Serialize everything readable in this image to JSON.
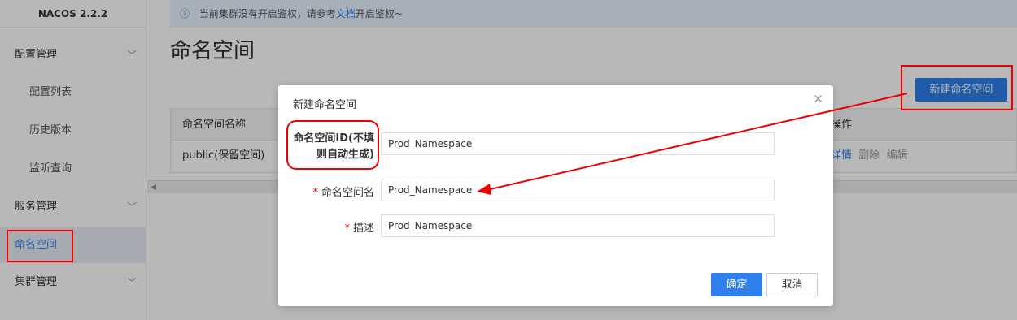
{
  "brand": "NACOS 2.2.2",
  "sidebar": {
    "groups": [
      {
        "label": "配置管理",
        "children": [
          "配置列表",
          "历史版本",
          "监听查询"
        ]
      },
      {
        "label": "服务管理"
      },
      {
        "label": "命名空间",
        "active": true
      },
      {
        "label": "集群管理"
      }
    ]
  },
  "notice": {
    "text_before": "当前集群没有开启鉴权，请参考",
    "link": "文档",
    "text_after": "开启鉴权~"
  },
  "page_title": "命名空间",
  "new_namespace_button": "新建命名空间",
  "table": {
    "columns": [
      "命名空间名称",
      "操作"
    ],
    "rows": [
      {
        "name": "public(保留空间)",
        "ops": [
          "详情",
          "删除",
          "编辑"
        ]
      }
    ]
  },
  "dialog": {
    "title": "新建命名空间",
    "fields": [
      {
        "label": "命名空间ID(不填则自动生成)",
        "label_line1": "命名空间ID(不填",
        "label_line2": "则自动生成)",
        "required": false,
        "value": "Prod_Namespace"
      },
      {
        "label": "命名空间名",
        "required": true,
        "value": "Prod_Namespace"
      },
      {
        "label": "描述",
        "required": true,
        "value": "Prod_Namespace"
      }
    ],
    "ok": "确定",
    "cancel": "取消"
  },
  "colors": {
    "accent": "#2f80ed",
    "annotation": "#e00000"
  }
}
